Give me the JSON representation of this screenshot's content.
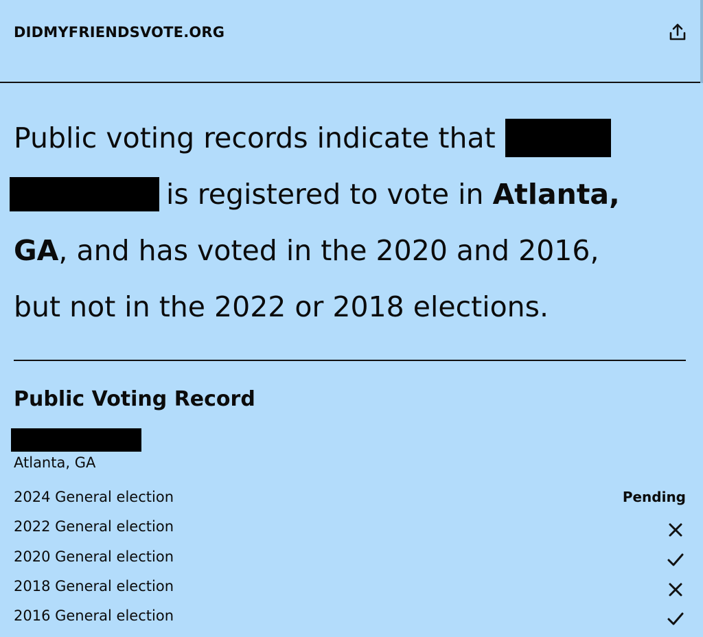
{
  "header": {
    "site_name": "DIDMYFRIENDSVOTE.ORG",
    "share_icon": "share-upload-icon"
  },
  "summary": {
    "part1": "Public voting records indicate that",
    "part2": "is registered to vote in",
    "city": "Atlanta,",
    "state": "GA",
    "part3": ", and has voted in the 2020 and 2016,",
    "part4": "but not in the 2022 or 2018 elections."
  },
  "record": {
    "title": "Public Voting Record",
    "location": "Atlanta, GA",
    "elections": [
      {
        "label": "2024 General election",
        "status": "Pending",
        "icon": ""
      },
      {
        "label": "2022 General election",
        "status": "",
        "icon": "x-icon"
      },
      {
        "label": "2020 General election",
        "status": "",
        "icon": "check-icon"
      },
      {
        "label": "2018 General election",
        "status": "",
        "icon": "x-icon"
      },
      {
        "label": "2016 General election",
        "status": "",
        "icon": "check-icon"
      }
    ]
  },
  "colors": {
    "background": "#b3dcfb",
    "text": "#0b0b0b",
    "redaction": "#000000"
  }
}
